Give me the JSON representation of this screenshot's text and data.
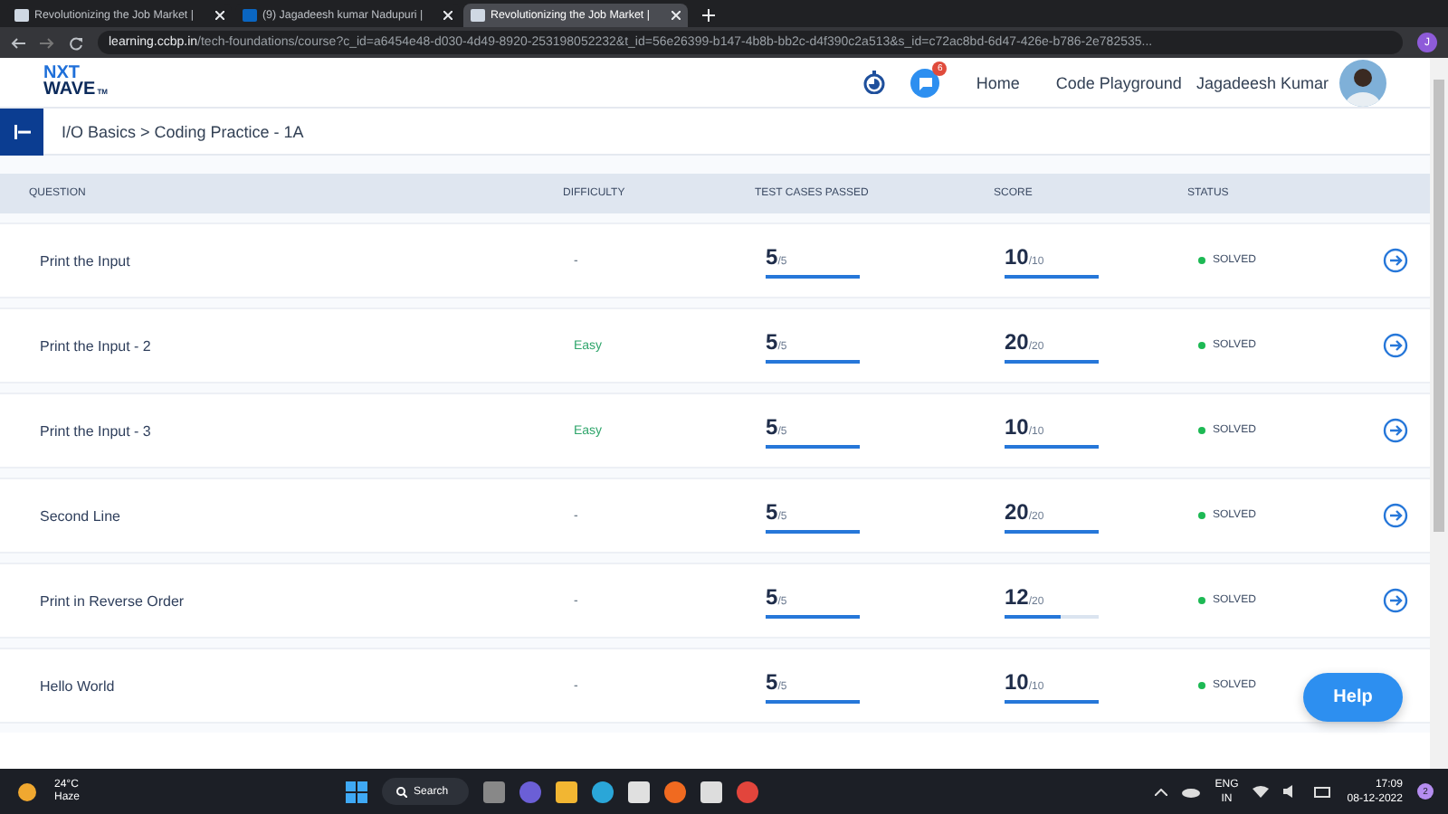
{
  "browser": {
    "tabs": [
      {
        "title": "Revolutionizing the Job Market |",
        "selected": false
      },
      {
        "title": "(9) Jagadeesh kumar Nadupuri |",
        "selected": false
      },
      {
        "title": "Revolutionizing the Job Market |",
        "selected": true
      }
    ],
    "address": {
      "host": "learning.ccbp.in",
      "path": "/tech-foundations/course?c_id=a6454e48-d030-4d49-8920-253198052232&t_id=56e26399-b147-4b8b-bb2c-d4f390c2a513&s_id=c72ac8bd-6d47-426e-b786-2e782535..."
    },
    "profile_initial": "J"
  },
  "header": {
    "logo": {
      "line1": "NXT",
      "line2": "WAVE",
      "mark": "TM"
    },
    "chat_badge": "6",
    "nav": [
      "Home",
      "Code Playground"
    ],
    "user": "Jagadeesh Kumar"
  },
  "breadcrumb": "I/O Basics > Coding Practice - 1A",
  "table": {
    "columns": [
      "QUESTION",
      "DIFFICULTY",
      "TEST CASES PASSED",
      "SCORE",
      "STATUS"
    ],
    "rows": [
      {
        "question": "Print the Input",
        "difficulty": {
          "text": "-"
        },
        "passed": {
          "value": "5",
          "total": "/5",
          "level": 1
        },
        "score": {
          "value": "10",
          "total": "/10",
          "level": 1
        },
        "status": "SOLVED",
        "color": "#1db954"
      },
      {
        "question": "Print the Input - 2",
        "difficulty": {
          "text": "Easy",
          "color": "#2fa56b"
        },
        "passed": {
          "value": "5",
          "total": "/5",
          "level": 1
        },
        "score": {
          "value": "20",
          "total": "/20",
          "level": 1
        },
        "status": "SOLVED",
        "color": "#1db954"
      },
      {
        "question": "Print the Input - 3",
        "difficulty": {
          "text": "Easy",
          "color": "#2fa56b"
        },
        "passed": {
          "value": "5",
          "total": "/5",
          "level": 1
        },
        "score": {
          "value": "10",
          "total": "/10",
          "level": 1
        },
        "status": "SOLVED",
        "color": "#1db954"
      },
      {
        "question": "Second Line",
        "difficulty": {
          "text": "-"
        },
        "passed": {
          "value": "5",
          "total": "/5",
          "level": 1
        },
        "score": {
          "value": "20",
          "total": "/20",
          "level": 1
        },
        "status": "SOLVED",
        "color": "#1db954"
      },
      {
        "question": "Print in Reverse Order",
        "difficulty": {
          "text": "-"
        },
        "passed": {
          "value": "5",
          "total": "/5",
          "level": 1
        },
        "score": {
          "value": "12",
          "total": "/20",
          "level": 0.6
        },
        "status": "SOLVED",
        "color": "#1db954"
      },
      {
        "question": "Hello World",
        "difficulty": {
          "text": "-"
        },
        "passed": {
          "value": "5",
          "total": "/5",
          "level": 1
        },
        "score": {
          "value": "10",
          "total": "/10",
          "level": 1
        },
        "status": "SOLVED",
        "color": "#1db954",
        "open_button": false
      }
    ]
  },
  "help_button": "Help",
  "taskbar": {
    "temperature": "24°C",
    "weather": "Haze",
    "search": "Search",
    "language": "ENG",
    "region": "IN",
    "time": "17:09",
    "date": "08-12-2022",
    "notifications": "2"
  }
}
